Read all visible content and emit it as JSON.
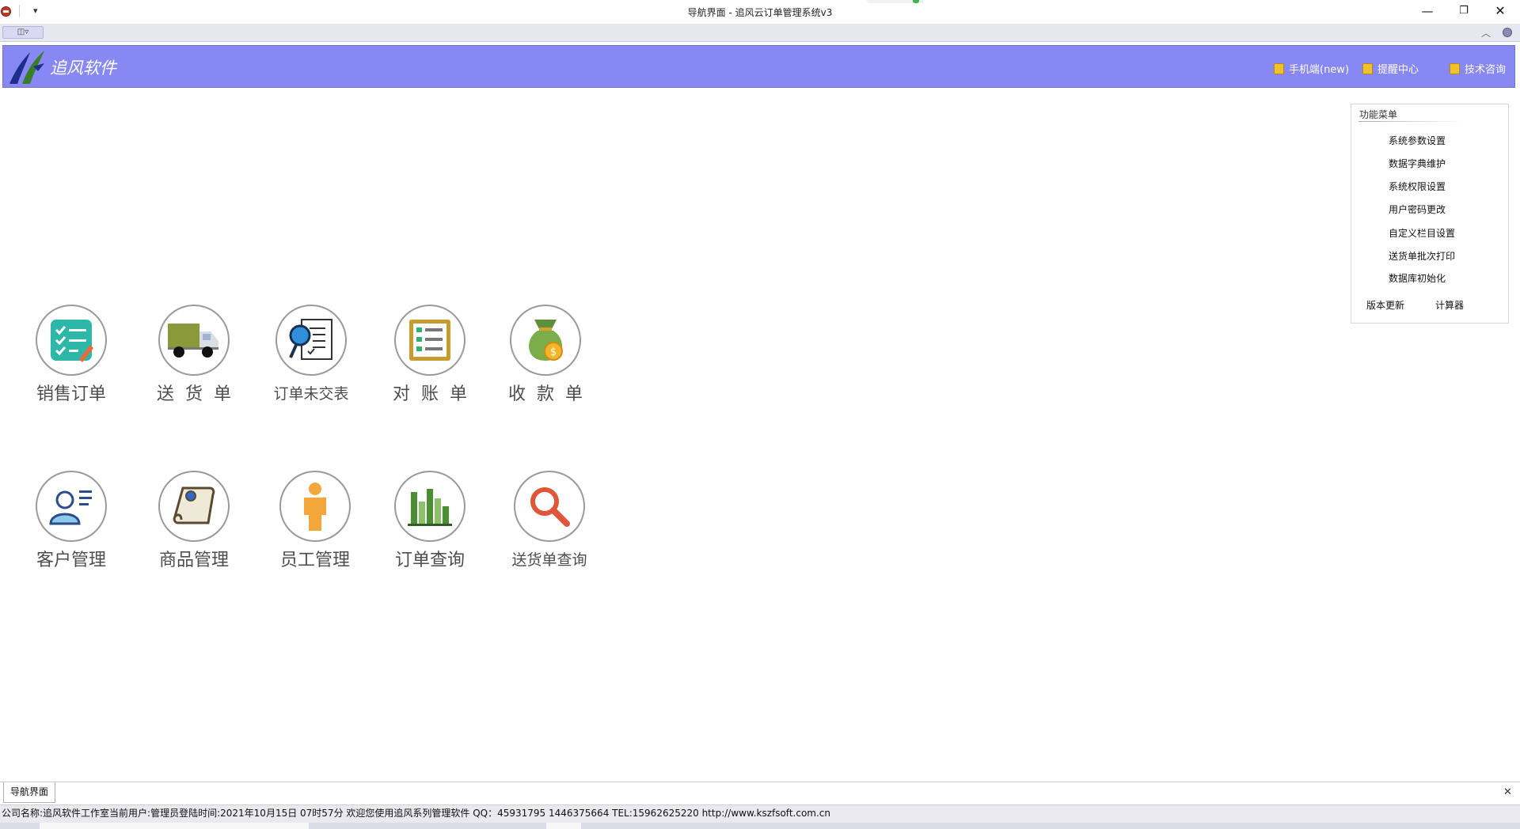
{
  "window": {
    "title": "导航界面 - 追风云订单管理系统v3",
    "min_glyph": "—",
    "max_glyph": "❐",
    "close_glyph": "✕",
    "quick_access_glyph": "▾"
  },
  "ribbon": {
    "toggle_glyph": "◫▿",
    "collapse_glyph": "︿"
  },
  "banner": {
    "logo_text": "追风软件",
    "links": [
      {
        "label": "手机端(new)",
        "icon": "note-icon"
      },
      {
        "label": "提醒中心",
        "icon": "note-icon"
      },
      {
        "label": "技术咨询",
        "icon": "note-icon"
      }
    ]
  },
  "tiles": [
    {
      "label": "销售订单",
      "icon": "checklist-icon"
    },
    {
      "label": "送货单",
      "icon": "truck-icon"
    },
    {
      "label": "订单未交表",
      "icon": "document-search-icon"
    },
    {
      "label": "对账单",
      "icon": "ledger-icon"
    },
    {
      "label": "收款单",
      "icon": "money-bag-icon"
    },
    {
      "label": "客户管理",
      "icon": "customer-icon"
    },
    {
      "label": "商品管理",
      "icon": "scroll-icon"
    },
    {
      "label": "员工管理",
      "icon": "person-icon"
    },
    {
      "label": "订单查询",
      "icon": "bar-chart-icon"
    },
    {
      "label": "送货单查询",
      "icon": "magnifier-icon"
    }
  ],
  "side_menu": {
    "title": "功能菜单",
    "items": [
      "系统参数设置",
      "数据字典维护",
      "系统权限设置",
      "用户密码更改",
      "自定义栏目设置",
      "送货单批次打印",
      "数据库初始化"
    ],
    "bottom": [
      "版本更新",
      "计算器"
    ]
  },
  "tabs": {
    "active": "导航界面",
    "close_glyph": "✕"
  },
  "status": {
    "text": "公司名称:追风软件工作室当前用户:管理员登陆时间:2021年10月15日 07时57分 欢迎您使用追风系列管理软件 QQ：45931795 1446375664 TEL:15962625220 http://www.kszfsoft.com.cn"
  },
  "colors": {
    "banner": "#8888f4",
    "tile_label": "#4d4d4d",
    "status_bg": "#e9e9ef"
  }
}
